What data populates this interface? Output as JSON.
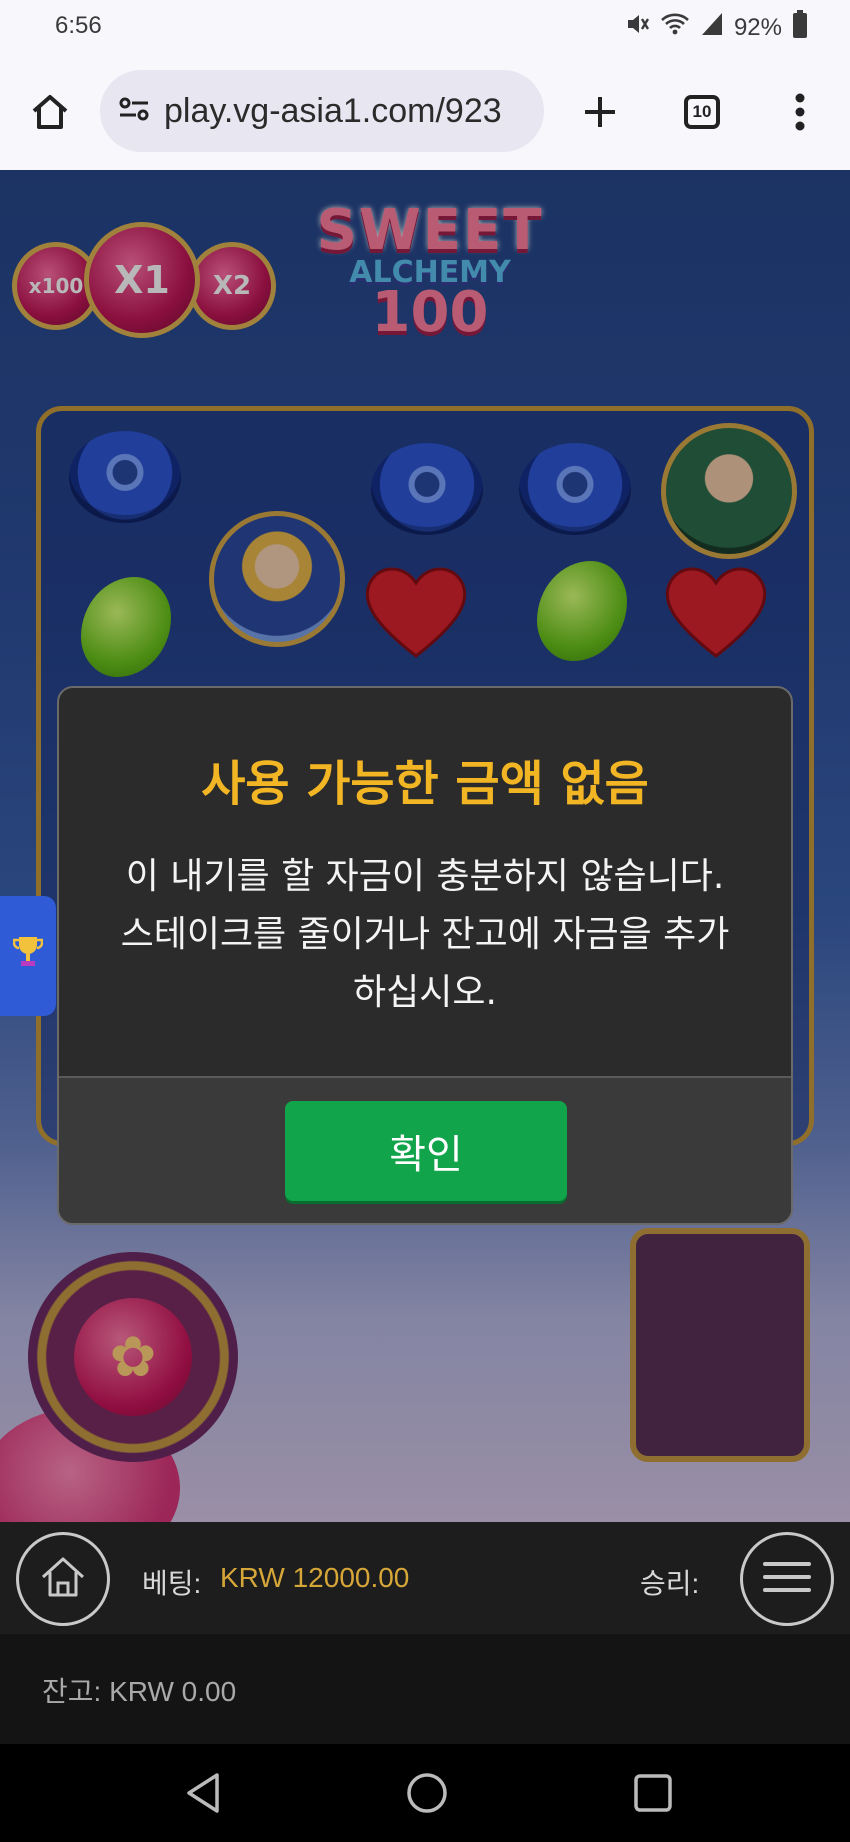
{
  "status_bar": {
    "time": "6:56",
    "battery": "92%",
    "icons": [
      "mute-icon",
      "wifi-icon",
      "signal-icon",
      "battery-icon"
    ]
  },
  "browser": {
    "url": "play.vg-asia1.com/923",
    "tab_count": "10",
    "icons": [
      "home-icon",
      "site-settings-icon",
      "new-tab-icon",
      "tabs-icon",
      "more-menu-icon"
    ]
  },
  "game": {
    "logo": {
      "line1": "SWEET",
      "line2": "ALCHEMY",
      "line3": "100"
    },
    "multipliers": [
      "x100",
      "X1",
      "X2"
    ]
  },
  "dialog": {
    "title": "사용 가능한 금액 없음",
    "message_line1": "이 내기를 할 자금이 충분하지 않습니다.",
    "message_line2": "스테이크를 줄이거나 잔고에 자금을 추가",
    "message_line3": "하십시오.",
    "ok_label": "확인"
  },
  "controls": {
    "bet_label": "베팅:",
    "bet_value": "KRW 12000.00",
    "win_label": "승리:",
    "balance": "잔고: KRW 0.00"
  },
  "colors": {
    "dialog_title": "#f2b625",
    "ok_button": "#12a44b",
    "bet_value": "#d6a639"
  }
}
